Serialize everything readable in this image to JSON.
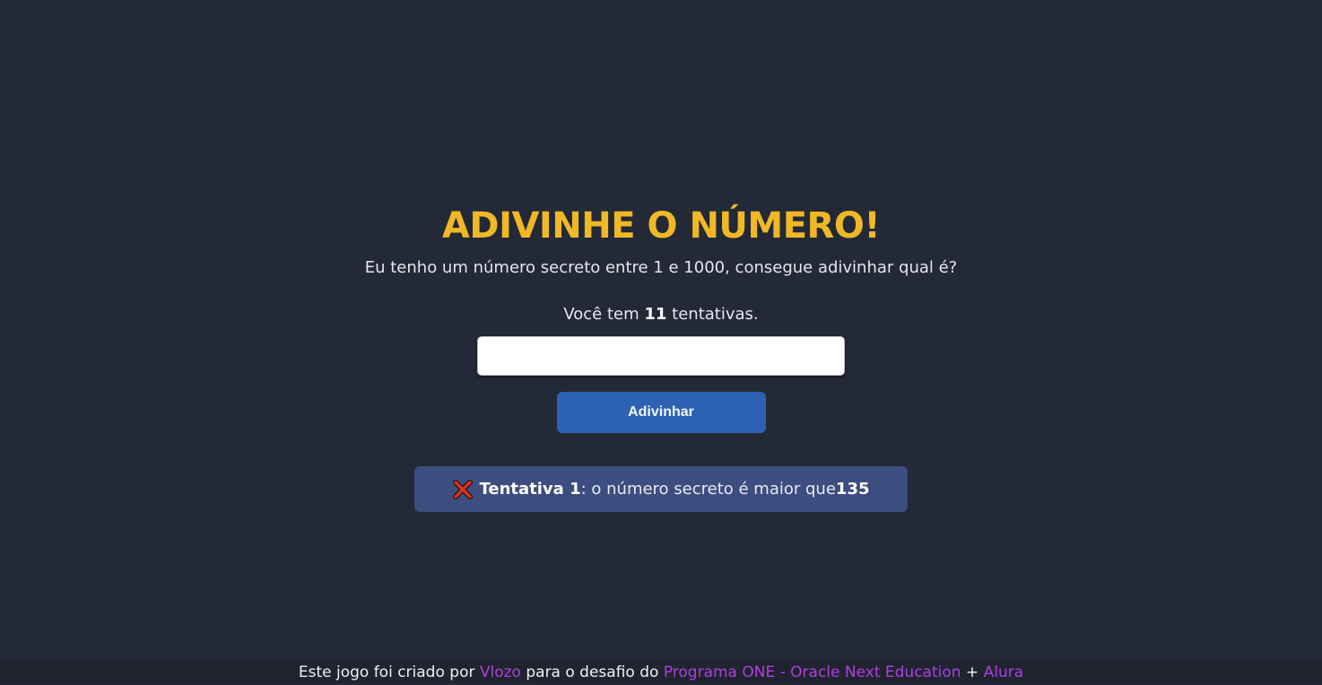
{
  "game": {
    "title": "ADIVINHE O NÚMERO!",
    "subtitle": "Eu tenho um número secreto entre 1 e 1000, consegue adivinhar qual é?",
    "attempts_prefix": "Você tem ",
    "attempts_count": "11",
    "attempts_suffix": " tentativas.",
    "input_value": "",
    "button_label": "Adivinhar"
  },
  "feedback": {
    "icon": "cross-mark-icon",
    "icon_color": "#d8331f",
    "attempt_label": "Tentativa 1",
    "message": ": o número secreto é maior que ",
    "number": "135"
  },
  "footer": {
    "text_1": "Este jogo foi criado por ",
    "author": "Vlozo",
    "text_2": " para o desafio do ",
    "program": "Programa ONE - Oracle Next Education",
    "text_3": " + ",
    "school": "Alura"
  },
  "colors": {
    "background": "#232936",
    "title": "#f0b826",
    "button": "#2d62b2",
    "feedback_box": "#3c4d7f",
    "link": "#b03fe0"
  }
}
